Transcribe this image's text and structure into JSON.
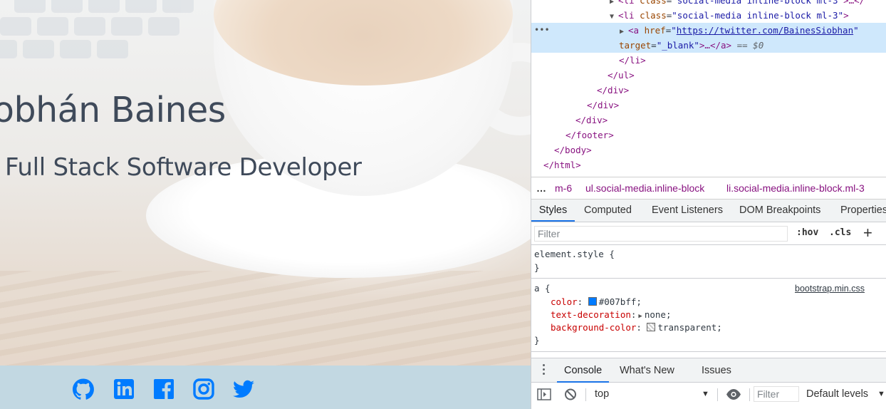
{
  "hero": {
    "name": "obhán Baines",
    "role": "Full Stack Software Developer"
  },
  "footer": {
    "social_icons": [
      "github-icon",
      "linkedin-icon",
      "facebook-icon",
      "instagram-icon",
      "twitter-icon"
    ],
    "icon_color": "#007bff"
  },
  "devtools": {
    "dom_lines": {
      "l0_tag": "<li ",
      "l0_attr": "class",
      "l0_eq": "=",
      "l0_val": "\"social-media inline-block ml-3\"",
      "l0_tail": ">…</",
      "l1_tag_open": "<li ",
      "l1_attr": "class",
      "l1_val": "\"social-media inline-block ml-3\"",
      "l1_close": ">",
      "l2_tag": "<a ",
      "l2_attr": "href",
      "l2_link": "https://twitter.com/BainesSiobhan",
      "l2_quote": "\"",
      "l3_attr": "target",
      "l3_val": "\"_blank\"",
      "l3_tail": ">…</a>",
      "l3_eq": " == $0",
      "l4": "</li>",
      "l5": "</ul>",
      "l6": "</div>",
      "l7": "</div>",
      "l8": "</div>",
      "l9": "</footer>",
      "l10": "</body>",
      "l11": "</html>"
    },
    "breadcrumbs": {
      "ellipsis": "…",
      "c0": "m-6",
      "c1_tag": "ul",
      "c1_cls": ".social-media.inline-block",
      "c2_tag": "li",
      "c2_cls": ".social-media.inline-block.ml-3"
    },
    "tabs": [
      "Styles",
      "Computed",
      "Event Listeners",
      "DOM Breakpoints",
      "Properties"
    ],
    "filter_placeholder": "Filter",
    "hov": ":hov",
    "cls": ".cls",
    "plus": "+",
    "rules": {
      "element_style": "element.style {",
      "close": "}",
      "a_selector": "a {",
      "a_source": "bootstrap.min.css",
      "p1_name": "color",
      "p1_value": "#007bff;",
      "p1_color": "#007bff",
      "p2_name": "text-decoration",
      "p2_value": "none;",
      "p3_name": "background-color",
      "p3_value": "transparent;"
    },
    "drawer_tabs": [
      "Console",
      "What's New",
      "Issues"
    ],
    "console": {
      "context": "top",
      "filter_placeholder": "Filter",
      "levels": "Default levels"
    }
  }
}
